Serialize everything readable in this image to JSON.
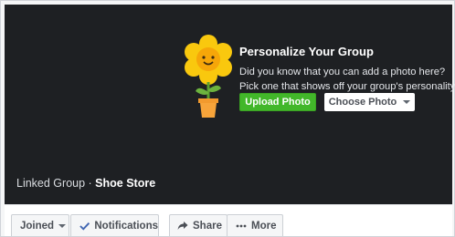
{
  "cover": {
    "title": "Personalize Your Group",
    "line1": "Did you know that you can add a photo here?",
    "line2": "Pick one that shows off your group's personality.",
    "upload_label": "Upload Photo",
    "choose_label": "Choose Photo",
    "group_prefix": "Linked Group · ",
    "group_name": "Shoe Store"
  },
  "actions": {
    "joined": "Joined",
    "notifications": "Notifications",
    "share": "Share",
    "more": "More"
  },
  "icons": {
    "flower": "sunflower-pot-icon",
    "caret": "caret-down-icon",
    "check": "checkmark-icon",
    "share": "share-arrow-icon",
    "more": "ellipsis-icon"
  },
  "colors": {
    "cover_bg": "#1e2023",
    "upload_green": "#42b72a",
    "check_blue": "#4267b2"
  }
}
